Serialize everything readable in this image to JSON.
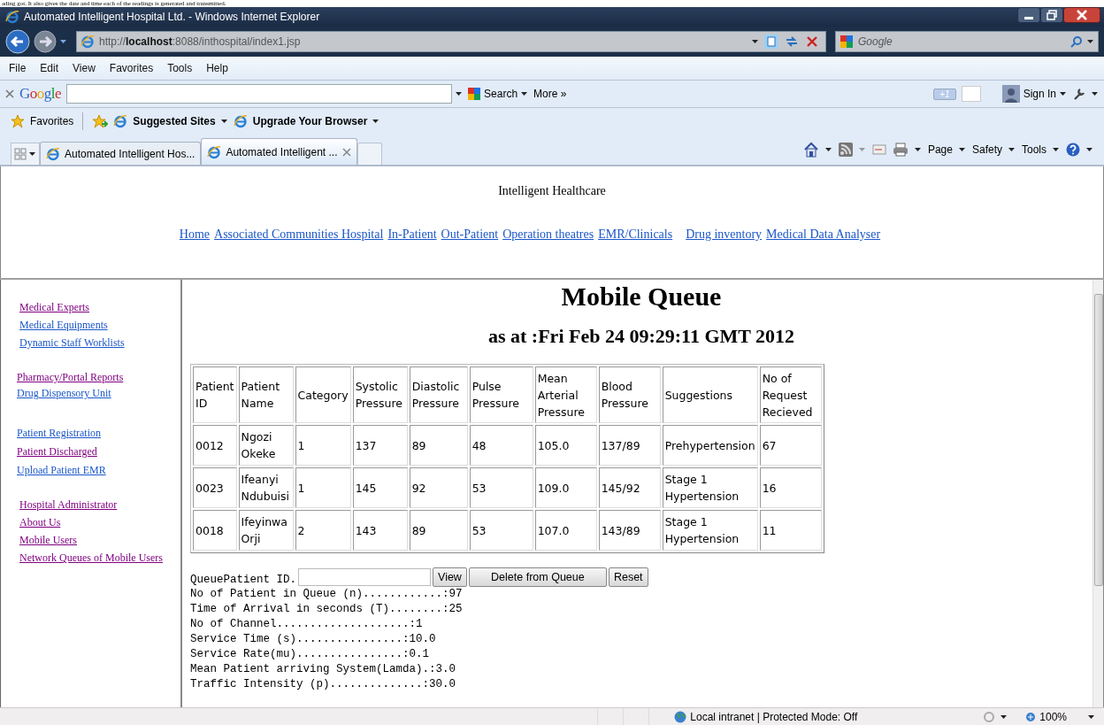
{
  "document_text": "ading got. It also gives the date and time each of the readings is generated and transmitted.",
  "window": {
    "title": "Automated Intelligent Hospital Ltd. - Windows Internet Explorer"
  },
  "address_bar": {
    "url": "http://**localhost**:8088/inthospital/index1.jsp"
  },
  "search_box": {
    "placeholder": "Google"
  },
  "menu_bar": [
    "File",
    "Edit",
    "View",
    "Favorites",
    "Tools",
    "Help"
  ],
  "google_toolbar": {
    "logo": "Google",
    "search_button": "Search",
    "more": "More »",
    "plus_one": "+1",
    "sign_in": "Sign In"
  },
  "favorites_bar": {
    "favorites": "Favorites",
    "links": [
      "Suggested Sites",
      "Upgrade Your Browser"
    ]
  },
  "tabs": [
    {
      "label": "Automated Intelligent Hos...",
      "selected": false
    },
    {
      "label": "Automated Intelligent ...",
      "selected": true
    }
  ],
  "command_bar": [
    "Page",
    "Safety",
    "Tools"
  ],
  "site_header": {
    "title": "Intelligent Healthcare",
    "nav": [
      {
        "label": "Home",
        "visited": false
      },
      {
        "label": "Associated Communities Hospital",
        "visited": false
      },
      {
        "label": "In-Patient",
        "visited": false
      },
      {
        "label": "Out-Patient",
        "visited": false
      },
      {
        "label": "Operation theatres",
        "visited": false
      },
      {
        "label": "EMR/Clinicals",
        "visited": false
      },
      {
        "label": "Drug inventory",
        "visited": false
      },
      {
        "label": "Medical Data Analyser",
        "visited": false
      }
    ]
  },
  "sidebar": {
    "groups": [
      {
        "items": [
          {
            "label": "Medical Experts",
            "visited": true
          },
          {
            "label": "Medical Equipments",
            "visited": false
          },
          {
            "label": "Dynamic Staff Worklists",
            "visited": false
          }
        ]
      },
      {
        "items": [
          {
            "label": "Pharmacy/Portal Reports",
            "visited": true
          },
          {
            "label": "Drug Dispensory Unit",
            "visited": false
          }
        ]
      },
      {
        "items": [
          {
            "label": "Patient Registration",
            "visited": false
          },
          {
            "label": "Patient Discharged",
            "visited": true
          },
          {
            "label": "Upload Patient EMR",
            "visited": false
          }
        ]
      },
      {
        "items": [
          {
            "label": "Hospital Administrator",
            "visited": true
          },
          {
            "label": "About Us",
            "visited": true
          },
          {
            "label": "Mobile Users",
            "visited": true
          },
          {
            "label": "Network Queues of Mobile Users",
            "visited": true
          }
        ]
      }
    ]
  },
  "content": {
    "heading": "Mobile Queue",
    "subheading": "as at :Fri Feb 24 09:29:11 GMT 2012",
    "table": {
      "columns": [
        "Patient ID",
        "Patient Name",
        "Category",
        "Systolic Pressure",
        "Diastolic Pressure",
        "Pulse Pressure",
        "Mean Arterial Pressure",
        "Blood Pressure",
        "Suggestions",
        "No of Request Recieved"
      ],
      "rows": [
        [
          "0012",
          "Ngozi Okeke",
          "1",
          "137",
          "89",
          "48",
          "105.0",
          "137/89",
          "Prehypertension",
          "67"
        ],
        [
          "0023",
          "Ifeanyi Ndubuisi",
          "1",
          "145",
          "92",
          "53",
          "109.0",
          "145/92",
          "Stage 1 Hypertension",
          "16"
        ],
        [
          "0018",
          "Ifeyinwa Orji",
          "2",
          "143",
          "89",
          "53",
          "107.0",
          "143/89",
          "Stage 1 Hypertension",
          "11"
        ]
      ]
    },
    "form": {
      "label": "QueuePatient ID.",
      "buttons": [
        "View",
        "Delete from Queue",
        "Reset"
      ]
    },
    "stats": [
      "No of Patient in Queue (n)............:97",
      "Time of Arrival in seconds (T)........:25",
      "No of Channel....................:1",
      "Service Time (s)................:10.0",
      "Service Rate(mu)................:0.1",
      "Mean Patient arriving System(Lamda).:3.0",
      "Traffic Intensity (p)..............:30.0"
    ]
  },
  "status_bar": {
    "zone": "Local intranet | Protected Mode: Off",
    "zoom": "100%"
  }
}
